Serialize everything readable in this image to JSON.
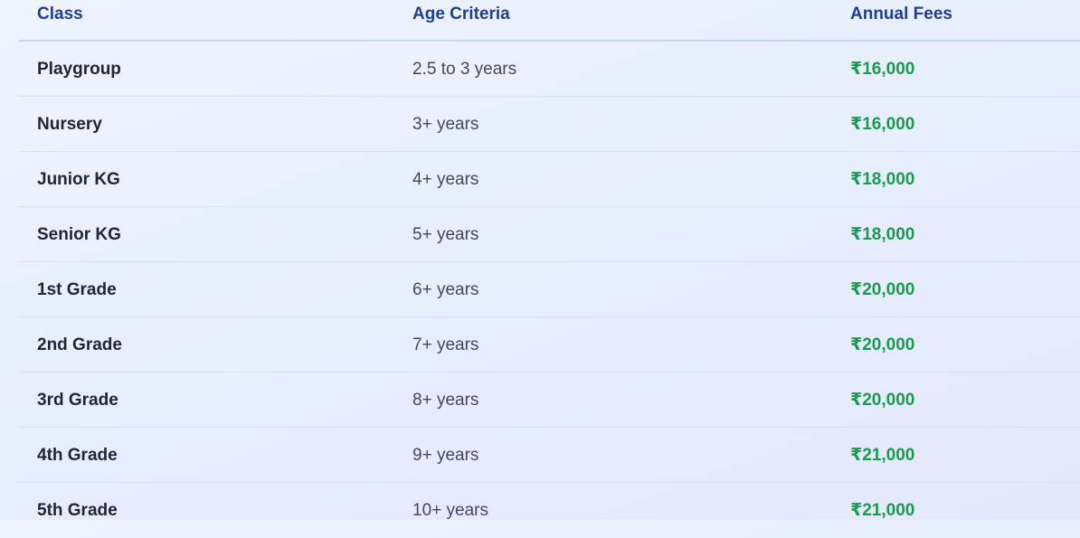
{
  "colors": {
    "header_text": "#1d3f94",
    "fee_text": "#1a9b4e",
    "class_text": "#1e2533",
    "age_text": "#414a5a"
  },
  "table": {
    "headers": {
      "class": "Class",
      "age": "Age Criteria",
      "fees": "Annual Fees"
    },
    "rows": [
      {
        "class": "Playgroup",
        "age": "2.5 to 3 years",
        "fees": "₹16,000"
      },
      {
        "class": "Nursery",
        "age": "3+ years",
        "fees": "₹16,000"
      },
      {
        "class": "Junior KG",
        "age": "4+ years",
        "fees": "₹18,000"
      },
      {
        "class": "Senior KG",
        "age": "5+ years",
        "fees": "₹18,000"
      },
      {
        "class": "1st Grade",
        "age": "6+ years",
        "fees": "₹20,000"
      },
      {
        "class": "2nd Grade",
        "age": "7+ years",
        "fees": "₹20,000"
      },
      {
        "class": "3rd Grade",
        "age": "8+ years",
        "fees": "₹20,000"
      },
      {
        "class": "4th Grade",
        "age": "9+ years",
        "fees": "₹21,000"
      },
      {
        "class": "5th Grade",
        "age": "10+ years",
        "fees": "₹21,000"
      }
    ]
  }
}
